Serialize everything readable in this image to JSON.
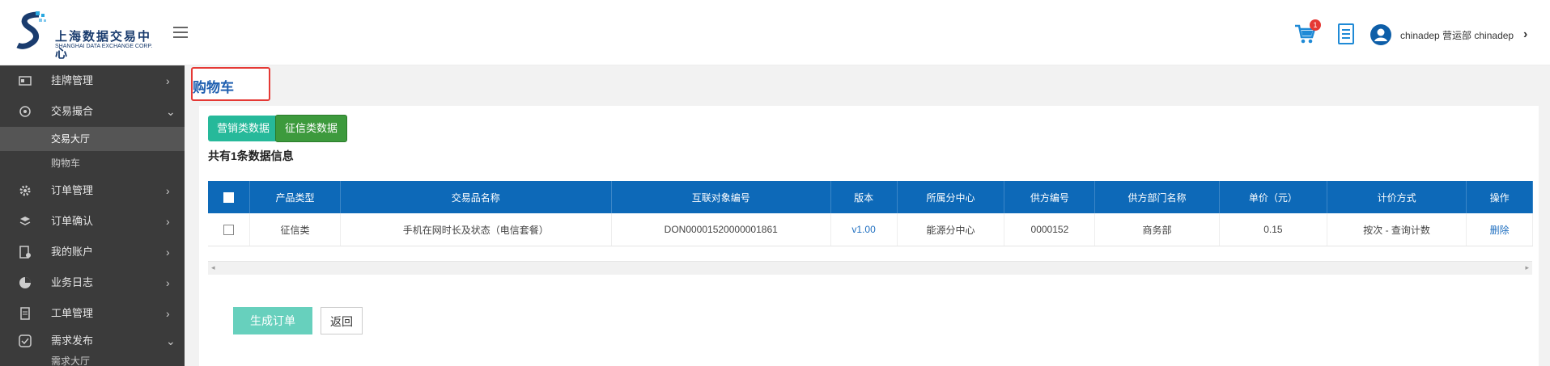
{
  "header": {
    "logo_cn": "上海数据交易中心",
    "logo_en": "SHANGHAI DATA EXCHANGE CORP.",
    "cart_count": "1",
    "user_label": "chinadep 营运部 chinadep",
    "colors": {
      "accent": "#0d69b8",
      "cart": "#1f8ad6"
    }
  },
  "sidebar": {
    "items": [
      {
        "label": "挂牌管理",
        "icon": "listing-icon",
        "arrow": "›"
      },
      {
        "label": "交易撮合",
        "icon": "match-icon",
        "arrow": "⌄"
      },
      {
        "label": "订单管理",
        "icon": "gear-icon",
        "arrow": "›"
      },
      {
        "label": "订单确认",
        "icon": "confirm-icon",
        "arrow": "›"
      },
      {
        "label": "我的账户",
        "icon": "account-icon",
        "arrow": "›"
      },
      {
        "label": "业务日志",
        "icon": "pie-icon",
        "arrow": "›"
      },
      {
        "label": "工单管理",
        "icon": "ticket-icon",
        "arrow": "›"
      },
      {
        "label": "需求发布",
        "icon": "check-icon",
        "arrow": "⌄"
      }
    ],
    "subitems": {
      "trade": [
        "交易大厅",
        "购物车"
      ],
      "demand": [
        "需求大厅"
      ]
    }
  },
  "main": {
    "title": "购物车",
    "tabs": [
      "营销类数据",
      "征信类数据"
    ],
    "summary": "共有1条数据信息",
    "table": {
      "headers": [
        "产品类型",
        "交易品名称",
        "互联对象编号",
        "版本",
        "所属分中心",
        "供方编号",
        "供方部门名称",
        "单价（元）",
        "计价方式",
        "操作"
      ],
      "rows": [
        [
          "征信类",
          "手机在网时长及状态（电信套餐）",
          "DON00001520000001861",
          "v1.00",
          "能源分中心",
          "0000152",
          "商务部",
          "0.15",
          "按次 - 查询计数",
          "删除"
        ]
      ]
    },
    "buttons": {
      "generate": "生成订单",
      "back": "返回"
    }
  }
}
